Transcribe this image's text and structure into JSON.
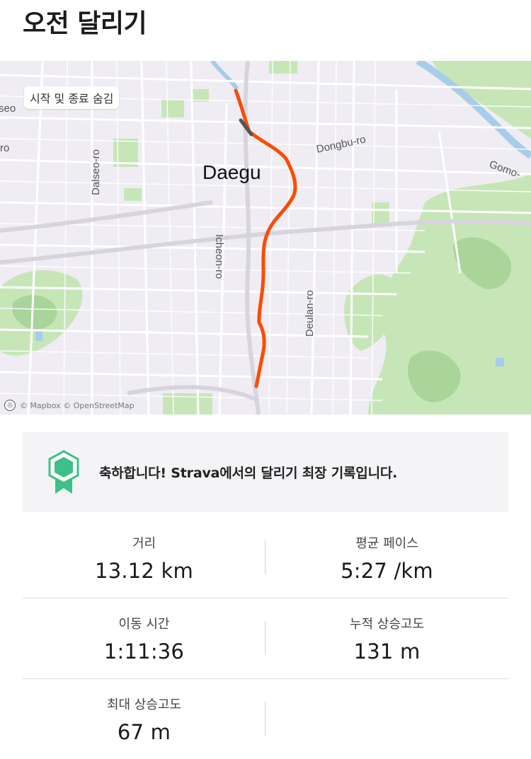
{
  "header": {
    "title": "오전 달리기"
  },
  "map": {
    "hide_start_end_label": "시작 및 종료 숨김",
    "city_label": "Daegu",
    "road_labels": {
      "dongbu": "Dongbu-ro",
      "gomo": "Gomo-",
      "dalseo": "Dalseo-ro",
      "icheon": "Icheon-ro",
      "deulan": "Deulan-ro",
      "seo": "seo",
      "ro": "ro"
    },
    "attribution": "© Mapbox © OpenStreetMap",
    "route_color": "#fc4c02"
  },
  "achievement": {
    "message": "축하합니다! Strava에서의 달리기 최장 기록입니다.",
    "badge_color": "#3fbf8a"
  },
  "stats": {
    "distance": {
      "label": "거리",
      "value": "13.12 km"
    },
    "avg_pace": {
      "label": "평균 페이스",
      "value": "5:27 /km"
    },
    "moving_time": {
      "label": "이동 시간",
      "value": "1:11:36"
    },
    "elevation_gain": {
      "label": "누적 상승고도",
      "value": "131 m"
    },
    "max_elevation": {
      "label": "최대 상승고도",
      "value": "67 m"
    }
  }
}
